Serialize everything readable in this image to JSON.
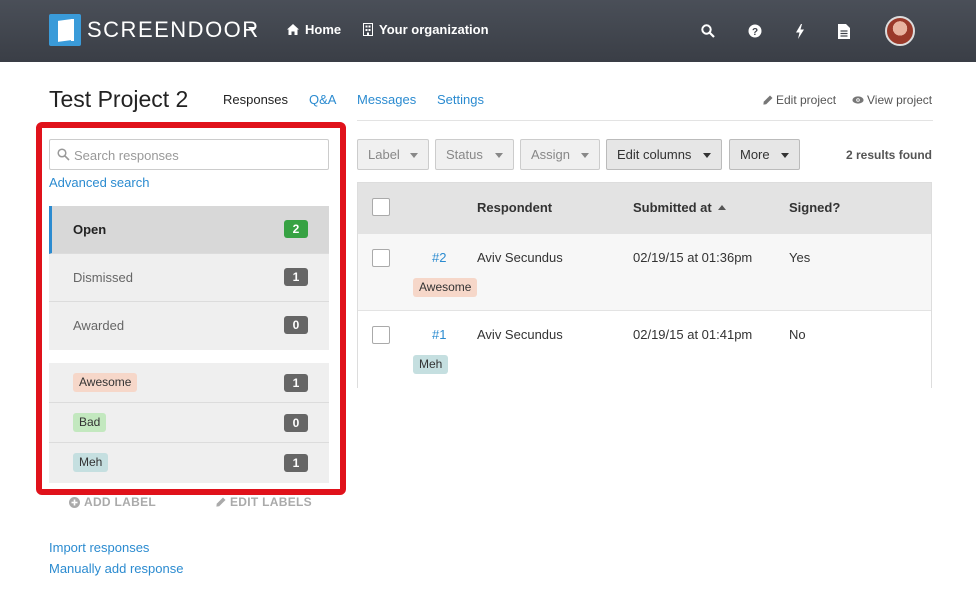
{
  "app": {
    "logo_text": "SCREENDOOR",
    "nav": {
      "home": "Home",
      "organization": "Your organization"
    },
    "icons": [
      "search-icon",
      "help-icon",
      "bolt-icon",
      "document-icon"
    ]
  },
  "header": {
    "title": "Test Project 2",
    "tabs": [
      {
        "label": "Responses",
        "active": true
      },
      {
        "label": "Q&A",
        "active": false
      },
      {
        "label": "Messages",
        "active": false
      },
      {
        "label": "Settings",
        "active": false
      }
    ],
    "edit_project": "Edit project",
    "view_project": "View project"
  },
  "sidebar": {
    "search_placeholder": "Search responses",
    "advanced_search": "Advanced search",
    "statuses": [
      {
        "label": "Open",
        "count": "2"
      },
      {
        "label": "Dismissed",
        "count": "1"
      },
      {
        "label": "Awarded",
        "count": "0"
      }
    ],
    "labels": [
      {
        "label": "Awesome",
        "count": "1",
        "color": "#f6d7c9"
      },
      {
        "label": "Bad",
        "count": "0",
        "color": "#c3e8bf"
      },
      {
        "label": "Meh",
        "count": "1",
        "color": "#c5dfe0"
      }
    ],
    "add_label": "ADD LABEL",
    "edit_labels": "EDIT LABELS",
    "import_responses": "Import responses",
    "manual_add": "Manually add response"
  },
  "toolbar": {
    "label": "Label",
    "status": "Status",
    "assign": "Assign",
    "edit_columns": "Edit columns",
    "more": "More",
    "results": "2 results found"
  },
  "table": {
    "columns": [
      "Respondent",
      "Submitted at",
      "Signed?"
    ],
    "rows": [
      {
        "id": "#2",
        "respondent": "Aviv Secundus",
        "submitted": "02/19/15 at 01:36pm",
        "signed": "Yes",
        "tag": "Awesome"
      },
      {
        "id": "#1",
        "respondent": "Aviv Secundus",
        "submitted": "02/19/15 at 01:41pm",
        "signed": "No",
        "tag": "Meh"
      }
    ]
  },
  "colors": {
    "accent": "#2b8bd0",
    "highlight": "#e0121b",
    "open_badge": "#37a243",
    "nav_bg": "#3e424a"
  }
}
